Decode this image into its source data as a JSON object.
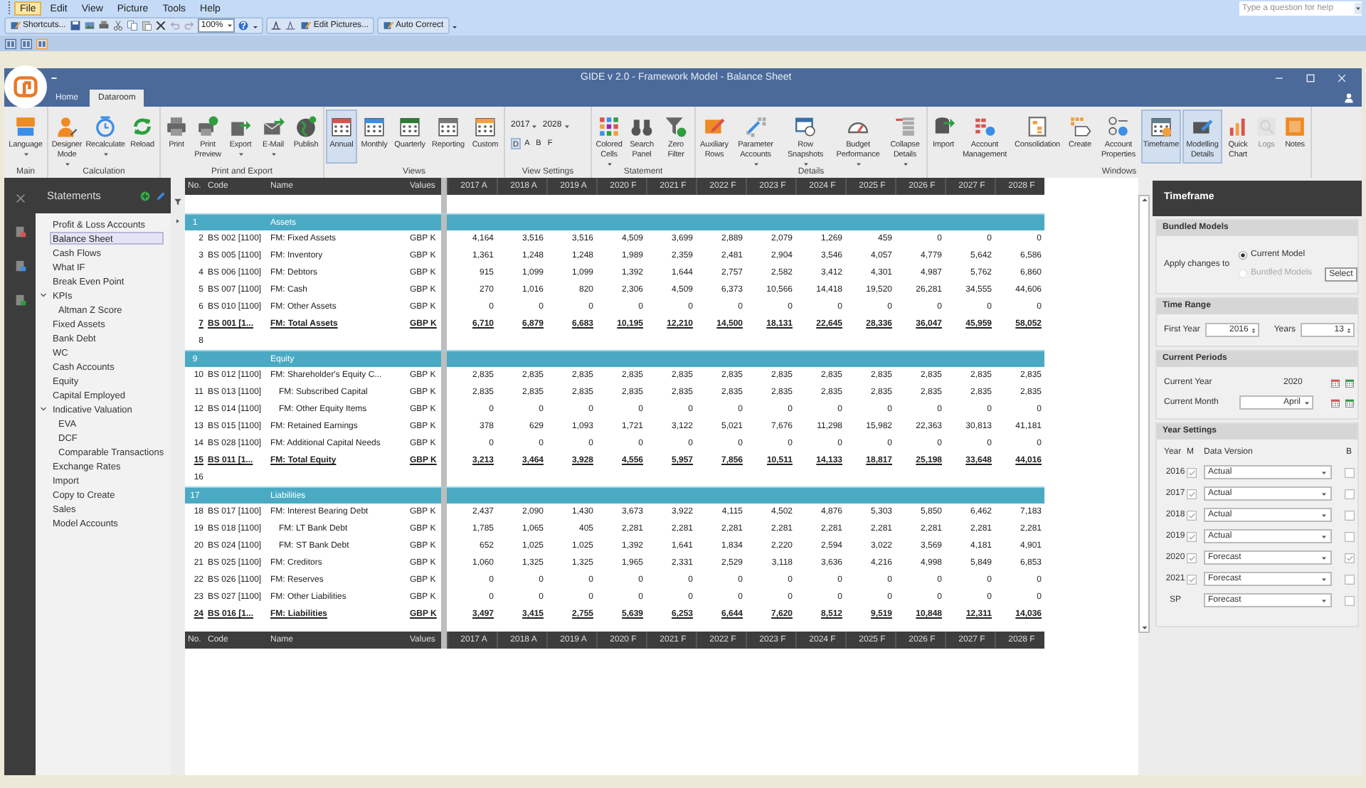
{
  "menu": [
    {
      "label": "File",
      "selected": true
    },
    {
      "label": "Edit",
      "selected": false
    },
    {
      "label": "View",
      "selected": false
    },
    {
      "label": "Picture",
      "selected": false
    },
    {
      "label": "Tools",
      "selected": false
    },
    {
      "label": "Help",
      "selected": false
    }
  ],
  "help_search": {
    "placeholder": "Type a question for help"
  },
  "toolbar": [
    {
      "kind": "text_button",
      "label": "Shortcuts..."
    },
    {
      "kind": "combo",
      "value": "100%"
    },
    {
      "kind": "text_button",
      "label": "Edit Pictures..."
    },
    {
      "kind": "text_button",
      "label": "Auto Correct"
    }
  ],
  "window": {
    "title": "GIDE v 2.0 - Framework Model - Balance Sheet"
  },
  "tabs": [
    {
      "label": "Home",
      "selected": false
    },
    {
      "label": "Dataroom",
      "selected": true
    }
  ],
  "ribbon": [
    {
      "label": "Main",
      "buttons": [
        {
          "label": "Language",
          "dropdown": true,
          "selected": false,
          "disabled": false
        }
      ]
    },
    {
      "label": "Calculation",
      "buttons": [
        {
          "label": "Designer Mode",
          "dropdown": true,
          "selected": false,
          "disabled": false
        },
        {
          "label": "Recalculate",
          "dropdown": true,
          "selected": false,
          "disabled": false
        },
        {
          "label": "Reload",
          "dropdown": false,
          "selected": false,
          "disabled": false
        }
      ]
    },
    {
      "label": "Print and Export",
      "buttons": [
        {
          "label": "Print",
          "dropdown": false,
          "selected": false,
          "disabled": false
        },
        {
          "label": "Print Preview",
          "dropdown": false,
          "selected": false,
          "disabled": false
        },
        {
          "label": "Export",
          "dropdown": true,
          "selected": false,
          "disabled": false
        },
        {
          "label": "E-Mail",
          "dropdown": true,
          "selected": false,
          "disabled": false
        },
        {
          "label": "Publish",
          "dropdown": false,
          "selected": false,
          "disabled": false
        }
      ]
    },
    {
      "label": "Views",
      "buttons": [
        {
          "label": "Annual",
          "dropdown": false,
          "selected": true,
          "disabled": false
        },
        {
          "label": "Monthly",
          "dropdown": false,
          "selected": false,
          "disabled": false
        },
        {
          "label": "Quarterly",
          "dropdown": false,
          "selected": false,
          "disabled": false
        },
        {
          "label": "Reporting",
          "dropdown": false,
          "selected": false,
          "disabled": false
        },
        {
          "label": "Custom",
          "dropdown": false,
          "selected": false,
          "disabled": false
        }
      ]
    },
    {
      "label": "View Settings",
      "kind": "settings",
      "from": "2017",
      "to": "2028",
      "letters": [
        {
          "label": "D",
          "selected": true
        },
        {
          "label": "A",
          "selected": false
        },
        {
          "label": "B",
          "selected": false
        },
        {
          "label": "F",
          "selected": false
        }
      ]
    },
    {
      "label": "Statement",
      "buttons": [
        {
          "label": "Colored Cells",
          "dropdown": true,
          "selected": false,
          "disabled": false
        },
        {
          "label": "Search Panel",
          "dropdown": false,
          "selected": false,
          "disabled": false
        },
        {
          "label": "Zero Filter",
          "dropdown": false,
          "selected": false,
          "disabled": false
        }
      ]
    },
    {
      "label": "Details",
      "buttons": [
        {
          "label": "Auxiliary Rows",
          "dropdown": false,
          "selected": false,
          "disabled": false
        },
        {
          "label": "Parameter Accounts",
          "dropdown": true,
          "selected": false,
          "disabled": false
        },
        {
          "label": "Row Snapshots",
          "dropdown": true,
          "selected": false,
          "disabled": false
        },
        {
          "label": "Budget Performance",
          "dropdown": true,
          "selected": false,
          "disabled": false
        },
        {
          "label": "Collapse Details",
          "dropdown": true,
          "selected": false,
          "disabled": false
        }
      ]
    },
    {
      "label": "Windows",
      "buttons": [
        {
          "label": "Import",
          "dropdown": false,
          "selected": false,
          "disabled": false
        },
        {
          "label": "Account Management",
          "dropdown": false,
          "selected": false,
          "disabled": false
        },
        {
          "label": "Consolidation",
          "dropdown": false,
          "selected": false,
          "disabled": false
        },
        {
          "label": "Create",
          "dropdown": false,
          "selected": false,
          "disabled": false
        },
        {
          "label": "Account Properties",
          "dropdown": false,
          "selected": false,
          "disabled": false
        },
        {
          "label": "Timeframe",
          "dropdown": false,
          "selected": true,
          "disabled": false
        },
        {
          "label": "Modelling Details",
          "dropdown": false,
          "selected": true,
          "disabled": false
        },
        {
          "label": "Quick Chart",
          "dropdown": false,
          "selected": false,
          "disabled": false
        },
        {
          "label": "Logs",
          "dropdown": false,
          "selected": false,
          "disabled": true
        },
        {
          "label": "Notes",
          "dropdown": false,
          "selected": false,
          "disabled": false
        }
      ]
    }
  ],
  "sidebar": {
    "title": "Statements",
    "items": [
      {
        "label": "Profit & Loss Accounts",
        "selected": false
      },
      {
        "label": "Balance Sheet",
        "selected": true
      },
      {
        "label": "Cash Flows",
        "selected": false
      },
      {
        "label": "What IF",
        "selected": false
      },
      {
        "label": "Break Even Point",
        "selected": false
      },
      {
        "label": "KPIs",
        "selected": false,
        "expanded": true,
        "children": [
          {
            "label": "Altman Z Score",
            "selected": false
          }
        ]
      },
      {
        "label": "Fixed Assets",
        "selected": false
      },
      {
        "label": "Bank Debt",
        "selected": false
      },
      {
        "label": "WC",
        "selected": false
      },
      {
        "label": "Cash Accounts",
        "selected": false
      },
      {
        "label": "Equity",
        "selected": false
      },
      {
        "label": "Capital Employed",
        "selected": false
      },
      {
        "label": "Indicative Valuation",
        "selected": false,
        "expanded": true,
        "children": [
          {
            "label": "EVA",
            "selected": false
          },
          {
            "label": "DCF",
            "selected": false
          },
          {
            "label": "Comparable Transactions",
            "selected": false
          }
        ]
      },
      {
        "label": "Exchange Rates",
        "selected": false
      },
      {
        "label": "Import",
        "selected": false
      },
      {
        "label": "Copy to Create",
        "selected": false
      },
      {
        "label": "Sales",
        "selected": false
      },
      {
        "label": "Model Accounts",
        "selected": false
      }
    ]
  },
  "table": {
    "columns": [
      "No.",
      "Code",
      "Name",
      "Values",
      "2017 A",
      "2018 A",
      "2019 A",
      "2020 F",
      "2021 F",
      "2022 F",
      "2023 F",
      "2024 F",
      "2025 F",
      "2026 F",
      "2027 F",
      "2028 F"
    ],
    "rows": [
      {
        "no": "1",
        "kind": "section",
        "name": "Assets"
      },
      {
        "no": "2",
        "kind": "data",
        "code": "BS 002 [1100]",
        "name": "FM: Fixed Assets",
        "unit": "GBP K",
        "values": [
          "4,164",
          "3,516",
          "3,516",
          "4,509",
          "3,699",
          "2,889",
          "2,079",
          "1,269",
          "459",
          "0",
          "0",
          "0"
        ]
      },
      {
        "no": "3",
        "kind": "data",
        "code": "BS 005 [1100]",
        "name": "FM: Inventory",
        "unit": "GBP K",
        "values": [
          "1,361",
          "1,248",
          "1,248",
          "1,989",
          "2,359",
          "2,481",
          "2,904",
          "3,546",
          "4,057",
          "4,779",
          "5,642",
          "6,586"
        ]
      },
      {
        "no": "4",
        "kind": "data",
        "code": "BS 006 [1100]",
        "name": "FM: Debtors",
        "unit": "GBP K",
        "values": [
          "915",
          "1,099",
          "1,099",
          "1,392",
          "1,644",
          "2,757",
          "2,582",
          "3,412",
          "4,301",
          "4,987",
          "5,762",
          "6,860"
        ]
      },
      {
        "no": "5",
        "kind": "data",
        "code": "BS 007 [1100]",
        "name": "FM: Cash",
        "unit": "GBP K",
        "values": [
          "270",
          "1,016",
          "820",
          "2,306",
          "4,509",
          "6,373",
          "10,566",
          "14,418",
          "19,520",
          "26,281",
          "34,555",
          "44,606"
        ]
      },
      {
        "no": "6",
        "kind": "data",
        "code": "BS 010 [1100]",
        "name": "FM: Other Assets",
        "unit": "GBP K",
        "values": [
          "0",
          "0",
          "0",
          "0",
          "0",
          "0",
          "0",
          "0",
          "0",
          "0",
          "0",
          "0"
        ]
      },
      {
        "no": "7",
        "kind": "total",
        "code": "BS 001 [1...",
        "name": "FM: Total Assets",
        "unit": "GBP K",
        "values": [
          "6,710",
          "6,879",
          "6,683",
          "10,195",
          "12,210",
          "14,500",
          "18,131",
          "22,645",
          "28,336",
          "36,047",
          "45,959",
          "58,052"
        ]
      },
      {
        "no": "8",
        "kind": "blank"
      },
      {
        "no": "9",
        "kind": "section",
        "name": "Equity"
      },
      {
        "no": "10",
        "kind": "data",
        "code": "BS 012 [1100]",
        "name": "FM: Shareholder's Equity C...",
        "unit": "GBP K",
        "values": [
          "2,835",
          "2,835",
          "2,835",
          "2,835",
          "2,835",
          "2,835",
          "2,835",
          "2,835",
          "2,835",
          "2,835",
          "2,835",
          "2,835"
        ]
      },
      {
        "no": "11",
        "kind": "sub",
        "code": "BS 013 [1100]",
        "name": "FM: Subscribed Capital",
        "unit": "GBP K",
        "values": [
          "2,835",
          "2,835",
          "2,835",
          "2,835",
          "2,835",
          "2,835",
          "2,835",
          "2,835",
          "2,835",
          "2,835",
          "2,835",
          "2,835"
        ]
      },
      {
        "no": "12",
        "kind": "sub",
        "code": "BS 014 [1100]",
        "name": "FM: Other Equity Items",
        "unit": "GBP K",
        "values": [
          "0",
          "0",
          "0",
          "0",
          "0",
          "0",
          "0",
          "0",
          "0",
          "0",
          "0",
          "0"
        ]
      },
      {
        "no": "13",
        "kind": "data",
        "code": "BS 015 [1100]",
        "name": "FM: Retained Earnings",
        "unit": "GBP K",
        "values": [
          "378",
          "629",
          "1,093",
          "1,721",
          "3,122",
          "5,021",
          "7,676",
          "11,298",
          "15,982",
          "22,363",
          "30,813",
          "41,181"
        ]
      },
      {
        "no": "14",
        "kind": "data",
        "code": "BS 028 [1100]",
        "name": "FM: Additional Capital Needs",
        "unit": "GBP K",
        "values": [
          "0",
          "0",
          "0",
          "0",
          "0",
          "0",
          "0",
          "0",
          "0",
          "0",
          "0",
          "0"
        ]
      },
      {
        "no": "15",
        "kind": "total",
        "code": "BS 011 [1...",
        "name": "FM: Total Equity",
        "unit": "GBP K",
        "values": [
          "3,213",
          "3,464",
          "3,928",
          "4,556",
          "5,957",
          "7,856",
          "10,511",
          "14,133",
          "18,817",
          "25,198",
          "33,648",
          "44,016"
        ]
      },
      {
        "no": "16",
        "kind": "blank"
      },
      {
        "no": "17",
        "kind": "section",
        "name": "Liabilities"
      },
      {
        "no": "18",
        "kind": "data",
        "code": "BS 017 [1100]",
        "name": "FM: Interest Bearing Debt",
        "unit": "GBP K",
        "values": [
          "2,437",
          "2,090",
          "1,430",
          "3,673",
          "3,922",
          "4,115",
          "4,502",
          "4,876",
          "5,303",
          "5,850",
          "6,462",
          "7,183"
        ]
      },
      {
        "no": "19",
        "kind": "sub",
        "code": "BS 018 [1100]",
        "name": "FM: LT Bank Debt",
        "unit": "GBP K",
        "values": [
          "1,785",
          "1,065",
          "405",
          "2,281",
          "2,281",
          "2,281",
          "2,281",
          "2,281",
          "2,281",
          "2,281",
          "2,281",
          "2,281"
        ]
      },
      {
        "no": "20",
        "kind": "sub",
        "code": "BS 024 [1100]",
        "name": "FM: ST Bank Debt",
        "unit": "GBP K",
        "values": [
          "652",
          "1,025",
          "1,025",
          "1,392",
          "1,641",
          "1,834",
          "2,220",
          "2,594",
          "3,022",
          "3,569",
          "4,181",
          "4,901"
        ]
      },
      {
        "no": "21",
        "kind": "data",
        "code": "BS 025 [1100]",
        "name": "FM: Creditors",
        "unit": "GBP K",
        "values": [
          "1,060",
          "1,325",
          "1,325",
          "1,965",
          "2,331",
          "2,529",
          "3,118",
          "3,636",
          "4,216",
          "4,998",
          "5,849",
          "6,853"
        ]
      },
      {
        "no": "22",
        "kind": "data",
        "code": "BS 026 [1100]",
        "name": "FM: Reserves",
        "unit": "GBP K",
        "values": [
          "0",
          "0",
          "0",
          "0",
          "0",
          "0",
          "0",
          "0",
          "0",
          "0",
          "0",
          "0"
        ]
      },
      {
        "no": "23",
        "kind": "data",
        "code": "BS 027 [1100]",
        "name": "FM: Other Liabilities",
        "unit": "GBP K",
        "values": [
          "0",
          "0",
          "0",
          "0",
          "0",
          "0",
          "0",
          "0",
          "0",
          "0",
          "0",
          "0"
        ]
      },
      {
        "no": "24",
        "kind": "total",
        "code": "BS 016 [1...",
        "name": "FM: Liabilities",
        "unit": "GBP K",
        "values": [
          "3,497",
          "3,415",
          "2,755",
          "5,639",
          "6,253",
          "6,644",
          "7,620",
          "8,512",
          "9,519",
          "10,848",
          "12,311",
          "14,036"
        ]
      }
    ],
    "footer_columns": [
      "No.",
      "Code",
      "Name",
      "Values",
      "2017 A",
      "2018 A",
      "2019 A",
      "2020 F",
      "2021 F",
      "2022 F",
      "2023 F",
      "2024 F",
      "2025 F",
      "2026 F",
      "2027 F",
      "2028 F"
    ]
  },
  "timeframe_panel": {
    "title": "Timeframe",
    "bundled_models": {
      "heading": "Bundled Models",
      "apply_label": "Apply changes to",
      "options": [
        {
          "label": "Current Model",
          "selected": true,
          "disabled": false
        },
        {
          "label": "Bundled Models",
          "selected": false,
          "disabled": true
        }
      ],
      "button": "Select"
    },
    "time_range": {
      "heading": "Time Range",
      "first_year_label": "First Year",
      "first_year": "2016",
      "years_label": "Years",
      "years": "13"
    },
    "current_periods": {
      "heading": "Current Periods",
      "year_label": "Current Year",
      "year": "2020",
      "month_label": "Current Month",
      "month": "April"
    },
    "year_settings": {
      "heading": "Year Settings",
      "columns": [
        "Year",
        "M",
        "Data Version",
        "B"
      ],
      "rows": [
        {
          "year": "2016",
          "m": true,
          "version": "Actual",
          "b": false
        },
        {
          "year": "2017",
          "m": true,
          "version": "Actual",
          "b": false
        },
        {
          "year": "2018",
          "m": true,
          "version": "Actual",
          "b": false
        },
        {
          "year": "2019",
          "m": true,
          "version": "Actual",
          "b": false
        },
        {
          "year": "2020",
          "m": true,
          "version": "Forecast",
          "b": true
        },
        {
          "year": "2021",
          "m": true,
          "version": "Forecast",
          "b": false
        },
        {
          "year": "SP",
          "version": "Forecast",
          "b": false
        }
      ]
    }
  }
}
